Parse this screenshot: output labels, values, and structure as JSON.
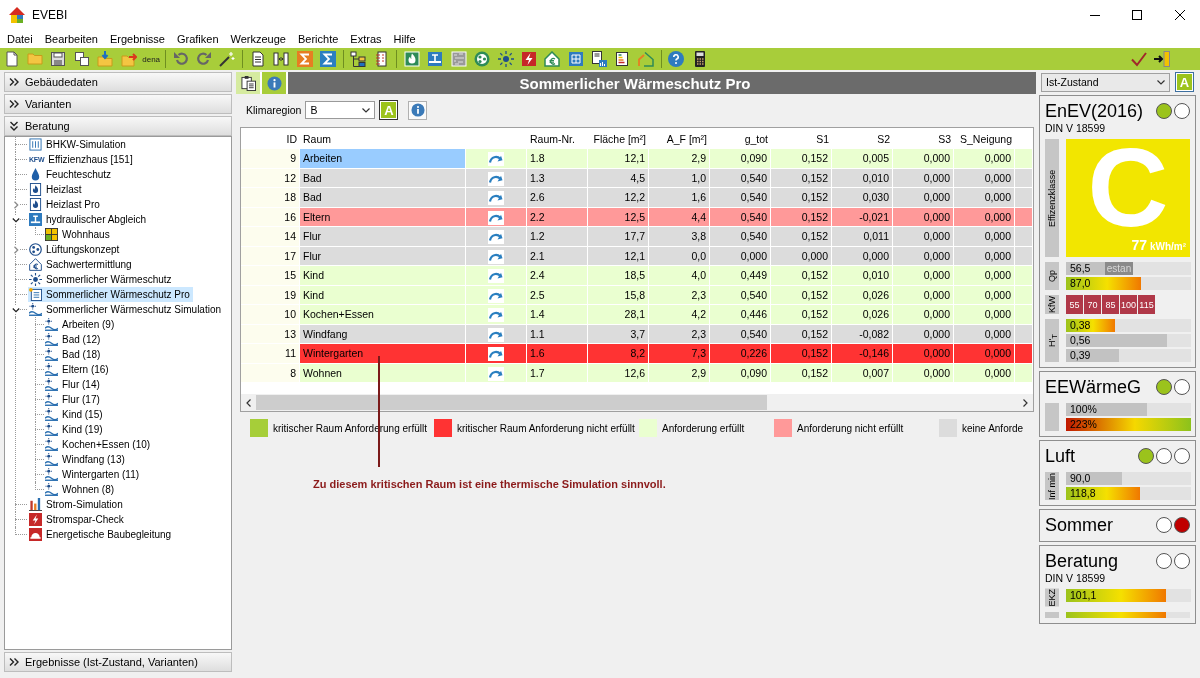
{
  "window": {
    "title": "EVEBI"
  },
  "menu": [
    "Datei",
    "Bearbeiten",
    "Ergebnisse",
    "Grafiken",
    "Werkzeuge",
    "Berichte",
    "Extras",
    "Hilfe"
  ],
  "toolbar": {
    "text_button": "dena"
  },
  "sidebar": {
    "sections": [
      {
        "label": "Gebäudedaten",
        "expanded": false
      },
      {
        "label": "Varianten",
        "expanded": false
      },
      {
        "label": "Beratung",
        "expanded": true,
        "items": [
          {
            "label": "BHKW-Simulation",
            "selected": false
          },
          {
            "label": "Effizienzhaus [151]",
            "logo": "KFW",
            "selected": false
          },
          {
            "label": "Feuchteschutz",
            "selected": false
          },
          {
            "label": "Heizlast",
            "selected": false
          },
          {
            "label": "Heizlast Pro",
            "expanded": false,
            "selected": false
          },
          {
            "label": "hydraulischer Abgleich",
            "expanded": true,
            "selected": false,
            "children": [
              {
                "label": "Wohnhaus",
                "selected": false
              }
            ]
          },
          {
            "label": "Lüftungskonzept",
            "expanded": false,
            "selected": false
          },
          {
            "label": "Sachwertermittlung",
            "selected": false
          },
          {
            "label": "Sommerlicher Wärmeschutz",
            "selected": false
          },
          {
            "label": "Sommerlicher Wärmeschutz Pro",
            "selected": true
          },
          {
            "label": "Sommerlicher Wärmeschutz Simulation",
            "expanded": true,
            "selected": false,
            "children": [
              {
                "label": "Arbeiten (9)",
                "selected": false
              },
              {
                "label": "Bad (12)",
                "selected": false
              },
              {
                "label": "Bad (18)",
                "selected": false
              },
              {
                "label": "Eltern (16)",
                "selected": false
              },
              {
                "label": "Flur (14)",
                "selected": false
              },
              {
                "label": "Flur (17)",
                "selected": false
              },
              {
                "label": "Kind (15)",
                "selected": false
              },
              {
                "label": "Kind (19)",
                "selected": false
              },
              {
                "label": "Kochen+Essen (10)",
                "selected": false
              },
              {
                "label": "Windfang (13)",
                "selected": false
              },
              {
                "label": "Wintergarten (11)",
                "selected": false
              },
              {
                "label": "Wohnen (8)",
                "selected": false
              }
            ]
          },
          {
            "label": "Strom-Simulation",
            "selected": false
          },
          {
            "label": "Stromspar-Check",
            "selected": false
          },
          {
            "label": "Energetische Baubegleitung",
            "selected": false
          }
        ]
      },
      {
        "label": "Ergebnisse (Ist-Zustand, Varianten)",
        "expanded": false
      }
    ]
  },
  "main": {
    "tabs": [
      {
        "selected": true
      },
      {
        "selected": false
      }
    ],
    "title": "Sommerlicher Wärmeschutz Pro",
    "climate": {
      "label": "Klimaregion",
      "value": "B",
      "button_label": "A"
    },
    "table": {
      "columns": [
        {
          "label": "ID",
          "kind": "key"
        },
        {
          "label": "Raum",
          "kind": "text"
        },
        {
          "kind": "icon"
        },
        {
          "label": "Raum-Nr.",
          "kind": "text"
        },
        {
          "label": "Fläche [m²]",
          "kind": "number"
        },
        {
          "label": "A_F [m²]",
          "kind": "number"
        },
        {
          "label": "g_tot",
          "kind": "number"
        },
        {
          "label": "S1",
          "kind": "number"
        },
        {
          "label": "S2",
          "kind": "number"
        },
        {
          "label": "S3",
          "kind": "number"
        },
        {
          "label": "S_Neigung",
          "kind": "number"
        }
      ],
      "rows": [
        {
          "color": "#eaffd0",
          "selected": true,
          "cells": [
            "9",
            "Arbeiten",
            "",
            "1.8",
            "12,1",
            "2,9",
            "0,090",
            "0,152",
            "0,005",
            "0,000",
            "0,000"
          ]
        },
        {
          "color": "#dcdcdc",
          "selected": false,
          "cells": [
            "12",
            "Bad",
            "",
            "1.3",
            "4,5",
            "1,0",
            "0,540",
            "0,152",
            "0,010",
            "0,000",
            "0,000"
          ]
        },
        {
          "color": "#dcdcdc",
          "selected": false,
          "cells": [
            "18",
            "Bad",
            "",
            "2.6",
            "12,2",
            "1,6",
            "0,540",
            "0,152",
            "0,030",
            "0,000",
            "0,000"
          ]
        },
        {
          "color": "#ff9999",
          "selected": false,
          "cells": [
            "16",
            "Eltern",
            "",
            "2.2",
            "12,5",
            "4,4",
            "0,540",
            "0,152",
            "-0,021",
            "0,000",
            "0,000"
          ]
        },
        {
          "color": "#dcdcdc",
          "selected": false,
          "cells": [
            "14",
            "Flur",
            "",
            "1.2",
            "17,7",
            "3,8",
            "0,540",
            "0,152",
            "0,011",
            "0,000",
            "0,000"
          ]
        },
        {
          "color": "#dcdcdc",
          "selected": false,
          "cells": [
            "17",
            "Flur",
            "",
            "2.1",
            "12,1",
            "0,0",
            "0,000",
            "0,000",
            "0,000",
            "0,000",
            "0,000"
          ]
        },
        {
          "color": "#eaffd0",
          "selected": false,
          "cells": [
            "15",
            "Kind",
            "",
            "2.4",
            "18,5",
            "4,0",
            "0,449",
            "0,152",
            "0,010",
            "0,000",
            "0,000"
          ]
        },
        {
          "color": "#eaffd0",
          "selected": false,
          "cells": [
            "19",
            "Kind",
            "",
            "2.5",
            "15,8",
            "2,3",
            "0,540",
            "0,152",
            "0,026",
            "0,000",
            "0,000"
          ]
        },
        {
          "color": "#eaffd0",
          "selected": false,
          "cells": [
            "10",
            "Kochen+Essen",
            "",
            "1.4",
            "28,1",
            "4,2",
            "0,446",
            "0,152",
            "0,026",
            "0,000",
            "0,000"
          ]
        },
        {
          "color": "#dcdcdc",
          "selected": false,
          "cells": [
            "13",
            "Windfang",
            "",
            "1.1",
            "3,7",
            "2,3",
            "0,540",
            "0,152",
            "-0,082",
            "0,000",
            "0,000"
          ]
        },
        {
          "color": "#ff3333",
          "selected": false,
          "cells": [
            "11",
            "Wintergarten",
            "",
            "1.6",
            "8,2",
            "7,3",
            "0,226",
            "0,152",
            "-0,146",
            "0,000",
            "0,000"
          ]
        },
        {
          "color": "#eaffd0",
          "selected": false,
          "cells": [
            "8",
            "Wohnen",
            "",
            "1.7",
            "12,6",
            "2,9",
            "0,090",
            "0,152",
            "0,007",
            "0,000",
            "0,000"
          ]
        }
      ]
    },
    "legend": [
      {
        "color": "#a6ce39",
        "label": "kritischer Raum Anforderung erfüllt"
      },
      {
        "color": "#ff3333",
        "label": "kritischer Raum Anforderung nicht erfüllt"
      },
      {
        "color": "#eaffd0",
        "label": "Anforderung erfüllt"
      },
      {
        "color": "#ff9999",
        "label": "Anforderung nicht erfüllt"
      },
      {
        "color": "#dcdcdc",
        "label": "keine Anforde"
      }
    ],
    "annotation": "Zu diesem kritischen Raum ist eine thermische Simulation sinnvoll."
  },
  "status_panel": {
    "variant": {
      "value": "Ist-Zustand",
      "button_label": "A"
    },
    "cards": [
      {
        "title": "EnEV(2016)",
        "subtitle": "DIN V 18599",
        "lights": [
          {
            "color": "#9bc31c"
          },
          {
            "color": "#ffffff"
          }
        ],
        "rating": {
          "label": "Effizenzklasse",
          "grade": "C",
          "value": "77",
          "unit": "kWh/m²"
        },
        "groups": [
          {
            "label": "Qp",
            "kind": "bars",
            "bars": [
              {
                "kind": "plain",
                "level": 0.31,
                "text": "56,5",
                "tag": "estan"
              },
              {
                "kind": "rising",
                "level": 0.6,
                "text": "87,0"
              }
            ]
          },
          {
            "label": "KfW",
            "kind": "tiles",
            "tiles": [
              "55",
              "70",
              "85",
              "100",
              "115"
            ]
          },
          {
            "label": "H'$_{T}$",
            "kind": "bars",
            "bars": [
              {
                "kind": "rising",
                "level": 0.39,
                "text": "0,38"
              },
              {
                "kind": "plain",
                "level": 0.81,
                "text": "0,56"
              },
              {
                "kind": "plain",
                "level": 0.42,
                "text": "0,39"
              }
            ]
          }
        ]
      },
      {
        "title": "EEWärmeG",
        "lights": [
          {
            "color": "#9bc31c"
          },
          {
            "color": "#ffffff"
          }
        ],
        "groups": [
          {
            "kind": "bars",
            "bars": [
              {
                "kind": "plain",
                "level": 0.65,
                "text": "100%"
              },
              {
                "kind": "falling",
                "level": 1,
                "text": "223%"
              }
            ]
          }
        ]
      },
      {
        "title": "Luft",
        "lights": [
          {
            "color": "#9bc31c"
          },
          {
            "color": "#ffffff"
          },
          {
            "color": "#ffffff"
          }
        ],
        "groups": [
          {
            "label": "Inf min",
            "kind": "bars",
            "bars": [
              {
                "kind": "plain",
                "level": 0.45,
                "text": "90,0"
              },
              {
                "kind": "rising",
                "level": 0.59,
                "text": "118,8"
              }
            ]
          }
        ]
      },
      {
        "title": "Sommer",
        "lights": [
          {
            "color": "#ffffff"
          },
          {
            "color": "#c00000"
          }
        ]
      },
      {
        "title": "Beratung",
        "subtitle": "DIN V 18599",
        "lights": [
          {
            "color": "#ffffff"
          },
          {
            "color": "#ffffff"
          }
        ],
        "groups": [
          {
            "label": "EKZ",
            "kind": "bars",
            "bars": [
              {
                "kind": "rising",
                "level": 0.8,
                "text": "101,1"
              }
            ]
          },
          {
            "kind": "bars",
            "bars": [
              {
                "kind": "rising",
                "level": 0.8
              }
            ]
          }
        ]
      }
    ]
  }
}
